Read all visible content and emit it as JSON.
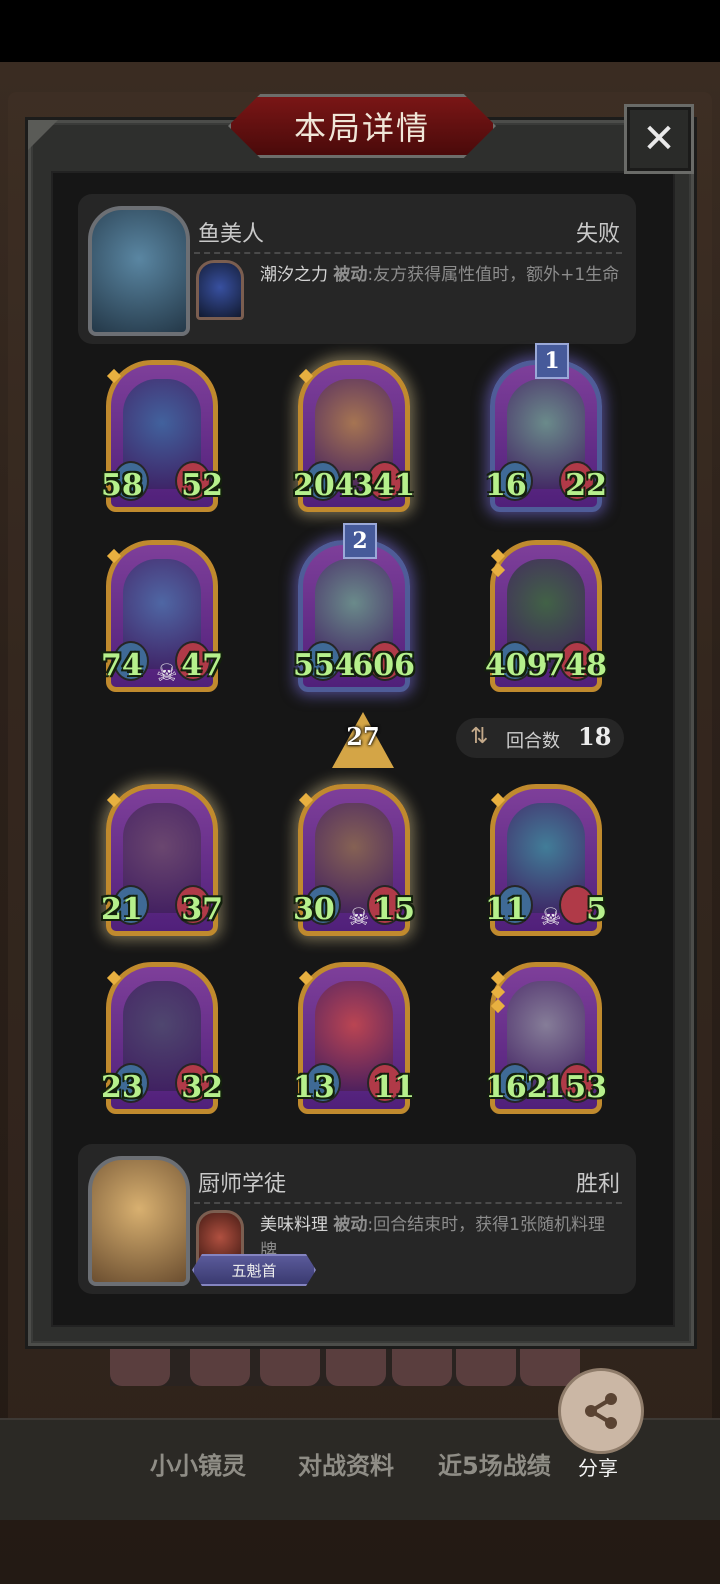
{
  "title": "本局详情",
  "close_icon": "✕",
  "opponent": {
    "name": "鱼美人",
    "result": "失败",
    "skill_name": "潮汐之力",
    "skill_tag": "被动",
    "skill_desc": ":友方获得属性值时，额外+1生命",
    "icon": "mermaid-portrait"
  },
  "player": {
    "name": "厨师学徒",
    "result": "胜利",
    "skill_name": "美味料理",
    "skill_tag": "被动",
    "skill_desc": ":回合结束时，获得1张随机料理牌",
    "badge": "五魁首",
    "icon": "chef-apprentice-portrait"
  },
  "opponent_cards": [
    {
      "atk": "58",
      "hp": "52"
    },
    {
      "atk": "204",
      "hp": "341"
    },
    {
      "atk": "16",
      "hp": "22",
      "tier": "1"
    },
    {
      "atk": "74",
      "hp": "47"
    },
    {
      "atk": "554",
      "hp": "606",
      "tier": "2"
    },
    {
      "atk": "409",
      "hp": "748"
    }
  ],
  "player_cards": [
    {
      "atk": "21",
      "hp": "37"
    },
    {
      "atk": "30",
      "hp": "15"
    },
    {
      "atk": "11",
      "hp": "5"
    },
    {
      "atk": "23",
      "hp": "32"
    },
    {
      "atk": "13",
      "hp": "11"
    },
    {
      "atk": "162",
      "hp": "153"
    }
  ],
  "level": "27",
  "round": {
    "label": "回合数",
    "value": "18"
  },
  "tabs": [
    "小小镜灵",
    "对战资料",
    "近5场战绩"
  ],
  "share_label": "分享",
  "colors": {
    "accent_gold": "#c08a2e",
    "stat_green": "#b6f08c",
    "title_red": "#7a1616"
  }
}
